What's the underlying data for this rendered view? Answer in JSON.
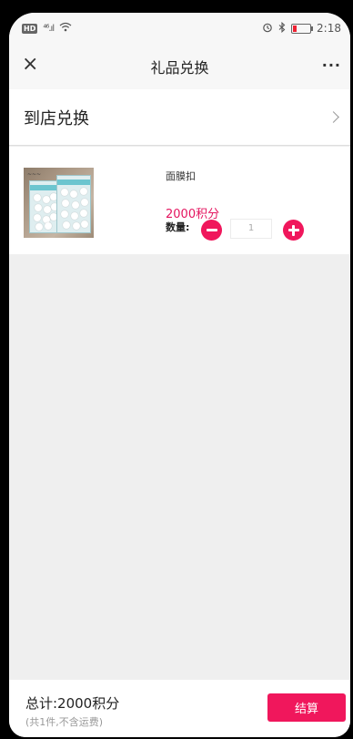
{
  "status_bar": {
    "hd": "HD",
    "signal": "⁴⁶.ıl",
    "time": "2:18"
  },
  "nav": {
    "close": "×",
    "title": "礼品兑换",
    "more": "···"
  },
  "store": {
    "label": "到店兑换"
  },
  "product": {
    "name": "面膜扣",
    "points": "2000积分",
    "qty_label": "数量:",
    "quantity": "1"
  },
  "footer": {
    "total": "总计:2000积分",
    "note": "(共1件,不含运费)",
    "checkout": "结算"
  },
  "colors": {
    "accent": "#f0175c",
    "points": "#e4155f"
  }
}
